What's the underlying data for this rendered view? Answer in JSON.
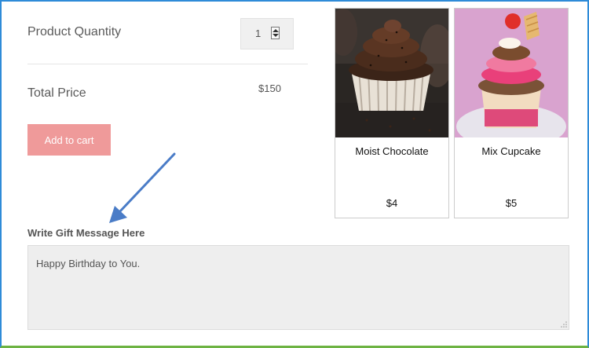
{
  "quantity": {
    "label": "Product Quantity",
    "value": "1"
  },
  "total": {
    "label": "Total Price",
    "value": "$150"
  },
  "cart": {
    "add_label": "Add to cart",
    "color": "#ef9a9a"
  },
  "gift": {
    "label": "Write Gift Message Here",
    "message": "Happy Birthday to You."
  },
  "products": [
    {
      "name": "Moist Chocolate",
      "price": "$4",
      "image": "chocolate-cupcake"
    },
    {
      "name": "Mix Cupcake",
      "price": "$5",
      "image": "mix-cupcake"
    }
  ],
  "colors": {
    "frame_side": "#2e8bd8",
    "frame_bottom": "#6db343",
    "arrow": "#4a7cc7"
  }
}
